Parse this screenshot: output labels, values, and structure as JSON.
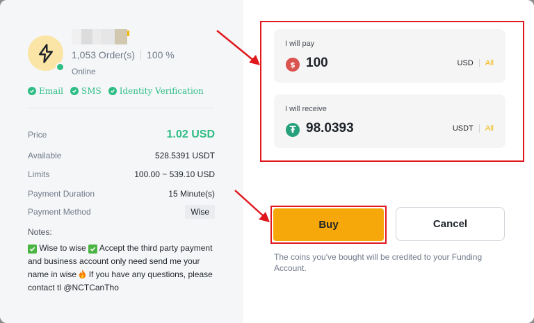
{
  "merchant": {
    "orders": "1,053 Order(s)",
    "completion": "100 %",
    "status": "Online",
    "avatar_icon": "lightning-icon"
  },
  "verifications": [
    "Email",
    "SMS",
    "Identity Verification"
  ],
  "details": {
    "price_label": "Price",
    "price_value": "1.02 USD",
    "available_label": "Available",
    "available_value": "528.5391 USDT",
    "limits_label": "Limits",
    "limits_value": "100.00 ~ 539.10 USD",
    "duration_label": "Payment Duration",
    "duration_value": "15 Minute(s)",
    "method_label": "Payment Method",
    "method_value": "Wise"
  },
  "notes": {
    "label": "Notes:",
    "part1": " Wise to wise ",
    "part2": " Accept the third party payment and business account only need send me your name in wise ",
    "part3": " If you have any questions, please contact tl @NCTCanTho"
  },
  "pay": {
    "label": "I will pay",
    "amount": "100",
    "currency": "USD",
    "all": "All",
    "coin_glyph": "$"
  },
  "receive": {
    "label": "I will receive",
    "amount": "98.0393",
    "currency": "USDT",
    "all": "All",
    "coin_glyph": "₮"
  },
  "actions": {
    "buy": "Buy",
    "cancel": "Cancel"
  },
  "footnote": "The coins you've bought will be credited to your Funding Account.",
  "colors": {
    "accent": "#f6a70a",
    "positive": "#2ebd85",
    "highlight": "#e0181e"
  }
}
